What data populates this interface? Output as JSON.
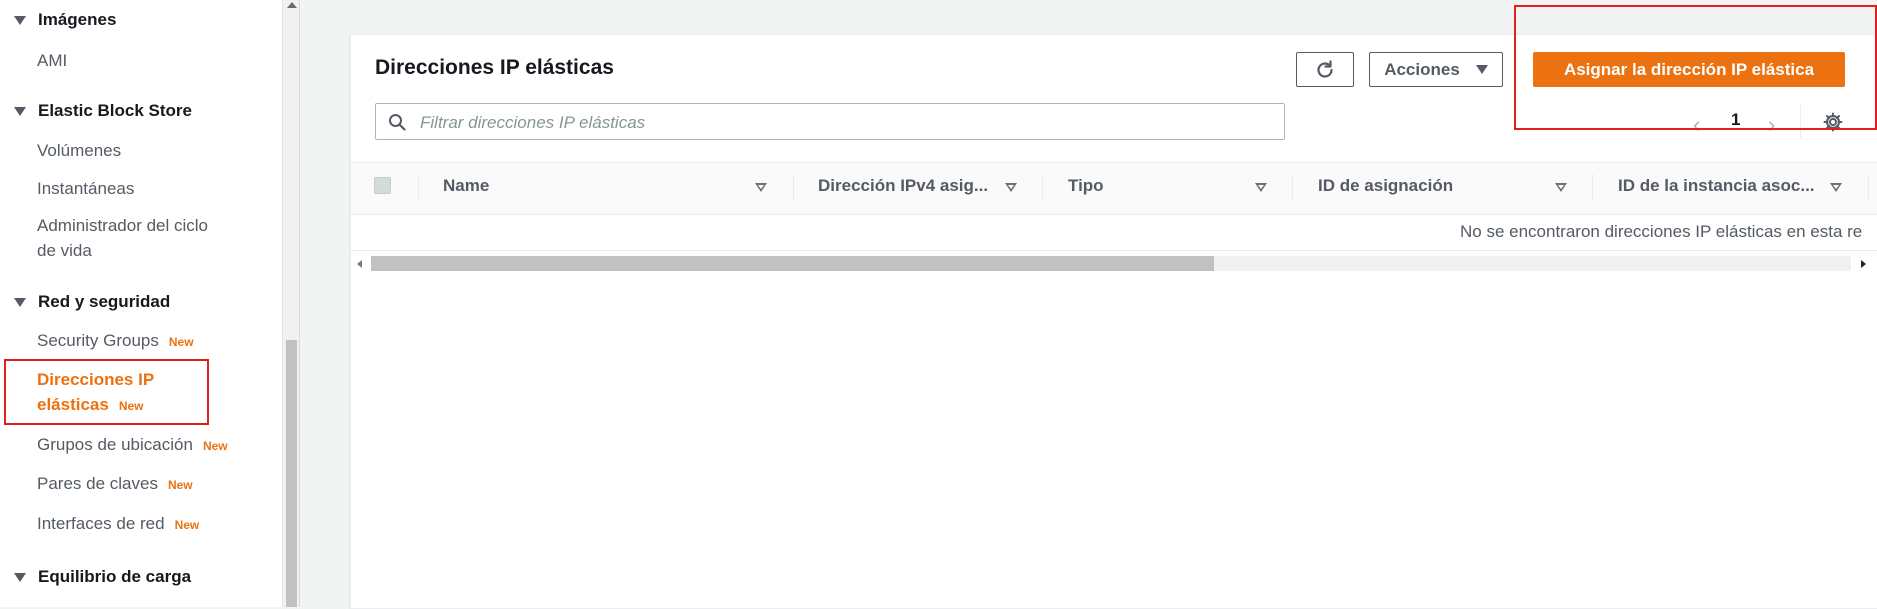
{
  "sidebar": {
    "sections": [
      {
        "title": "Imágenes"
      },
      {
        "title": "Elastic Block Store"
      },
      {
        "title": "Red y seguridad"
      },
      {
        "title": "Equilibrio de carga"
      }
    ],
    "items": {
      "ami": "AMI",
      "volumes": "Volúmenes",
      "snapshots": "Instantáneas",
      "lifecycle_line1": "Administrador del ciclo",
      "lifecycle_line2": "de vida",
      "security_groups": "Security Groups",
      "elastic_ips_line1": "Direcciones IP",
      "elastic_ips_line2": "elásticas",
      "placement_groups": "Grupos de ubicación",
      "key_pairs": "Pares de claves",
      "network_interfaces": "Interfaces de red"
    },
    "new_badge": "New"
  },
  "header": {
    "title": "Direcciones IP elásticas",
    "actions_label": "Acciones",
    "allocate_label": "Asignar la dirección IP elástica"
  },
  "search": {
    "placeholder": "Filtrar direcciones IP elásticas",
    "value": ""
  },
  "pagination": {
    "current_page": "1"
  },
  "table": {
    "columns": [
      "Name",
      "Dirección IPv4 asig...",
      "Tipo",
      "ID de asignación",
      "ID de la instancia asoc..."
    ],
    "empty_message": "No se encontraron direcciones IP elásticas en esta re"
  },
  "colors": {
    "accent": "#ec7211",
    "highlight_box": "#e0201f"
  }
}
